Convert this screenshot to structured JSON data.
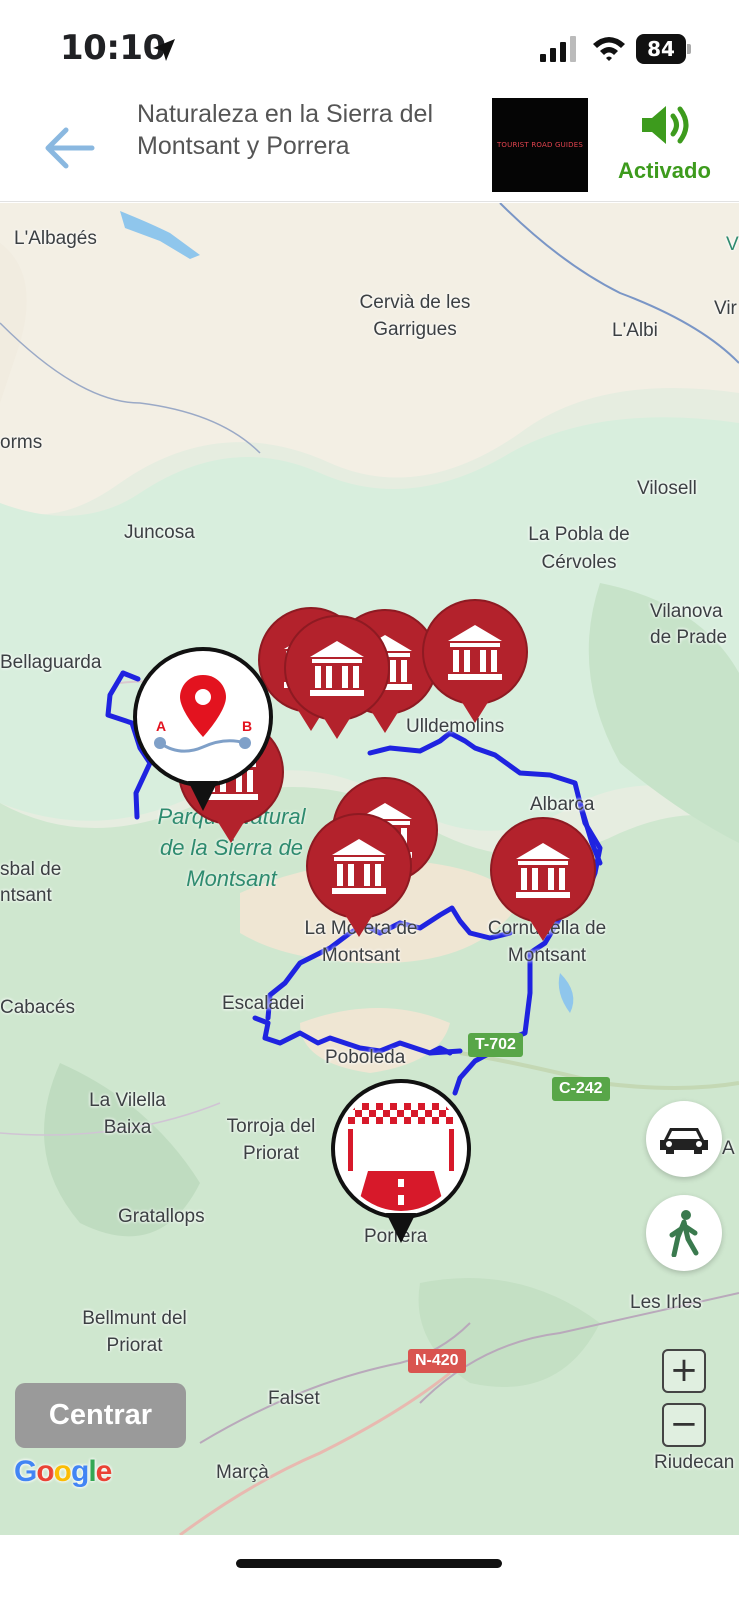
{
  "status_bar": {
    "time": "10:10",
    "battery": "84"
  },
  "header": {
    "title": "Naturaleza en la Sierra del Montsant y Porrera",
    "logo_text": "TOURIST ROAD GUIDES",
    "sound_label": "Activado"
  },
  "map": {
    "places": [
      {
        "name": "L'Albagés"
      },
      {
        "name": "Cervià de les Garrigues"
      },
      {
        "name": "L'Albi"
      },
      {
        "name": "Vir"
      },
      {
        "name": "V"
      },
      {
        "name": "orms"
      },
      {
        "name": "Vilosell"
      },
      {
        "name": "Juncosa"
      },
      {
        "name": "La Pobla de Cérvoles"
      },
      {
        "name": "Vilanova de Prade"
      },
      {
        "name": "Bellaguarda"
      },
      {
        "name": "Ulldemolins"
      },
      {
        "name": "Albarca"
      },
      {
        "name": "sbal de ntsant"
      },
      {
        "name": "La Morera de Montsant"
      },
      {
        "name": "Cornudella de Montsant"
      },
      {
        "name": "Cabacés"
      },
      {
        "name": "Escaladei"
      },
      {
        "name": "Poboleda"
      },
      {
        "name": "La Vilella Baixa"
      },
      {
        "name": "Torroja del Priorat"
      },
      {
        "name": "A"
      },
      {
        "name": "Gratallops"
      },
      {
        "name": "Porrera"
      },
      {
        "name": "Les Irles"
      },
      {
        "name": "Bellmunt del Priorat"
      },
      {
        "name": "Falset"
      },
      {
        "name": "Marçà"
      },
      {
        "name": "Riudecan"
      }
    ],
    "park_label": "Parque Natural de la Sierra de Montsant",
    "roads": {
      "t702": "T-702",
      "c242": "C-242",
      "n420": "N-420"
    },
    "route_color": "#1f23e0",
    "poi_color": "#b3222c",
    "start_icon": "route-a-to-b-pin-icon",
    "finish_icon": "finish-flag-road-icon",
    "start_labels": {
      "a": "A",
      "b": "B"
    }
  },
  "controls": {
    "center_label": "Centrar",
    "car_icon": "car-icon",
    "walk_icon": "walking-person-icon",
    "zoom_in": "+",
    "zoom_out": "−",
    "google": [
      "G",
      "o",
      "o",
      "g",
      "l",
      "e"
    ]
  }
}
